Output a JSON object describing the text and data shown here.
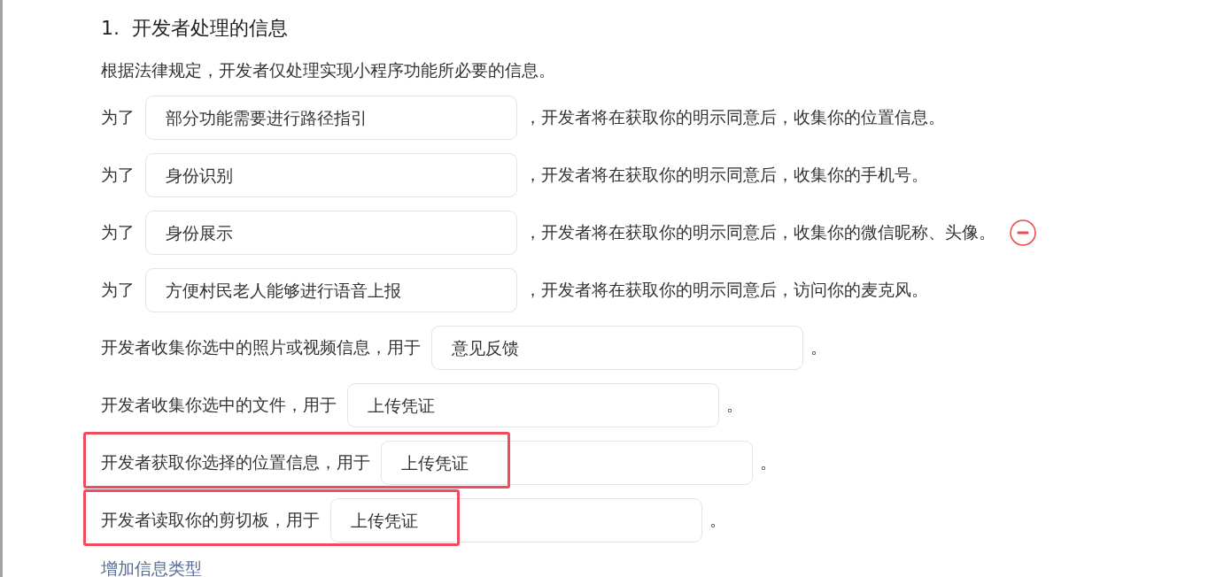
{
  "section": {
    "number": "1.",
    "title": "开发者处理的信息"
  },
  "intro": "根据法律规定，开发者仅处理实现小程序功能所必要的信息。",
  "items": [
    {
      "prefix": "为了",
      "value": "部分功能需要进行路径指引",
      "suffix": "，开发者将在获取你的明示同意后，收集你的位置信息。",
      "show_remove": false,
      "highlighted": false
    },
    {
      "prefix": "为了",
      "value": "身份识别",
      "suffix": "，开发者将在获取你的明示同意后，收集你的手机号。",
      "show_remove": false,
      "highlighted": false
    },
    {
      "prefix": "为了",
      "value": "身份展示",
      "suffix": "，开发者将在获取你的明示同意后，收集你的微信昵称、头像。",
      "show_remove": true,
      "highlighted": false
    },
    {
      "prefix": "为了",
      "value": "方便村民老人能够进行语音上报",
      "suffix": "，开发者将在获取你的明示同意后，访问你的麦克风。",
      "show_remove": false,
      "highlighted": false
    },
    {
      "prefix": "开发者收集你选中的照片或视频信息，用于",
      "value": "意见反馈",
      "suffix": "。",
      "show_remove": false,
      "highlighted": false
    },
    {
      "prefix": "开发者收集你选中的文件，用于",
      "value": "上传凭证",
      "suffix": "。",
      "show_remove": false,
      "highlighted": false
    },
    {
      "prefix": "开发者获取你选择的位置信息，用于",
      "value": "上传凭证",
      "suffix": "。",
      "show_remove": false,
      "highlighted": true
    },
    {
      "prefix": "开发者读取你的剪切板，用于",
      "value": "上传凭证",
      "suffix": "。",
      "show_remove": false,
      "highlighted": true
    }
  ],
  "add_link": "增加信息类型"
}
